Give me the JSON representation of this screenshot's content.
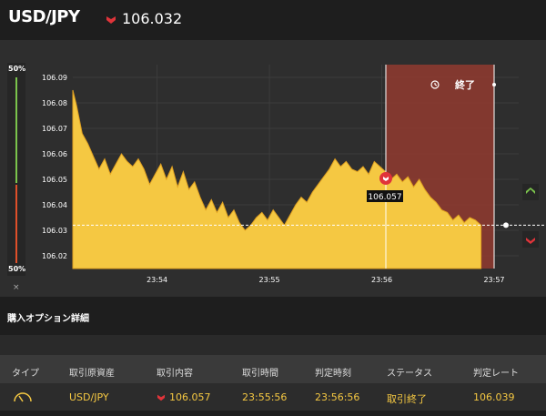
{
  "header": {
    "pair": "USD/JPY",
    "price": "106.032",
    "direction": "down"
  },
  "ratio": {
    "top_label": "50%",
    "bottom_label": "50%",
    "close_label": "×",
    "up_color": "#7bc44c",
    "down_color": "#e0502a"
  },
  "chart_data": {
    "type": "area",
    "y_ticks": [
      "106.09",
      "106.08",
      "106.07",
      "106.06",
      "106.05",
      "106.04",
      "106.03",
      "106.02"
    ],
    "x_ticks": [
      "23:54",
      "23:55",
      "23:56",
      "23:57"
    ],
    "ylim": [
      106.015,
      106.095
    ],
    "series": [
      {
        "color": "#f5c842",
        "points": [
          [
            "23:53:15",
            106.085
          ],
          [
            "23:53:17",
            106.079
          ],
          [
            "23:53:20",
            106.068
          ],
          [
            "23:53:23",
            106.064
          ],
          [
            "23:53:26",
            106.059
          ],
          [
            "23:53:29",
            106.054
          ],
          [
            "23:53:32",
            106.058
          ],
          [
            "23:53:35",
            106.052
          ],
          [
            "23:53:38",
            106.056
          ],
          [
            "23:53:41",
            106.06
          ],
          [
            "23:53:44",
            106.057
          ],
          [
            "23:53:47",
            106.055
          ],
          [
            "23:53:50",
            106.058
          ],
          [
            "23:53:53",
            106.054
          ],
          [
            "23:53:56",
            106.048
          ],
          [
            "23:53:59",
            106.052
          ],
          [
            "23:54:02",
            106.056
          ],
          [
            "23:54:05",
            106.05
          ],
          [
            "23:54:08",
            106.055
          ],
          [
            "23:54:11",
            106.047
          ],
          [
            "23:54:14",
            106.053
          ],
          [
            "23:54:17",
            106.046
          ],
          [
            "23:54:20",
            106.049
          ],
          [
            "23:54:23",
            106.043
          ],
          [
            "23:54:26",
            106.038
          ],
          [
            "23:54:29",
            106.042
          ],
          [
            "23:54:32",
            106.037
          ],
          [
            "23:54:35",
            106.041
          ],
          [
            "23:54:38",
            106.035
          ],
          [
            "23:54:41",
            106.038
          ],
          [
            "23:54:44",
            106.033
          ],
          [
            "23:54:47",
            106.03
          ],
          [
            "23:54:50",
            106.032
          ],
          [
            "23:54:53",
            106.035
          ],
          [
            "23:54:56",
            106.037
          ],
          [
            "23:54:59",
            106.034
          ],
          [
            "23:55:02",
            106.038
          ],
          [
            "23:55:05",
            106.035
          ],
          [
            "23:55:08",
            106.032
          ],
          [
            "23:55:11",
            106.036
          ],
          [
            "23:55:14",
            106.04
          ],
          [
            "23:55:17",
            106.043
          ],
          [
            "23:55:20",
            106.041
          ],
          [
            "23:55:23",
            106.045
          ],
          [
            "23:55:26",
            106.048
          ],
          [
            "23:55:29",
            106.051
          ],
          [
            "23:55:32",
            106.054
          ],
          [
            "23:55:35",
            106.058
          ],
          [
            "23:55:38",
            106.055
          ],
          [
            "23:55:41",
            106.057
          ],
          [
            "23:55:44",
            106.054
          ],
          [
            "23:55:47",
            106.053
          ],
          [
            "23:55:50",
            106.055
          ],
          [
            "23:55:53",
            106.052
          ],
          [
            "23:55:56",
            106.057
          ],
          [
            "23:55:59",
            106.055
          ],
          [
            "23:56:02",
            106.053
          ],
          [
            "23:56:05",
            106.05
          ],
          [
            "23:56:08",
            106.052
          ],
          [
            "23:56:11",
            106.049
          ],
          [
            "23:56:14",
            106.051
          ],
          [
            "23:56:17",
            106.047
          ],
          [
            "23:56:20",
            106.05
          ],
          [
            "23:56:23",
            106.046
          ],
          [
            "23:56:26",
            106.043
          ],
          [
            "23:56:29",
            106.041
          ],
          [
            "23:56:32",
            106.038
          ],
          [
            "23:56:35",
            106.037
          ],
          [
            "23:56:38",
            106.034
          ],
          [
            "23:56:41",
            106.036
          ],
          [
            "23:56:44",
            106.033
          ],
          [
            "23:56:47",
            106.035
          ],
          [
            "23:56:50",
            106.034
          ],
          [
            "23:56:53",
            106.032
          ]
        ]
      }
    ],
    "current_price_line": 106.032,
    "entry": {
      "time": "23:55:56",
      "price": "106.057",
      "direction": "down"
    },
    "expiry_time": "23:56:56",
    "expired_zone_label": "終了"
  },
  "options_section": {
    "title": "購入オプション詳細",
    "columns": [
      "タイプ",
      "取引原資産",
      "取引内容",
      "取引時間",
      "判定時刻",
      "ステータス",
      "判定レート"
    ],
    "rows": [
      {
        "asset": "USD/JPY",
        "trade": "106.057",
        "trade_direction": "down",
        "time": "23:55:56",
        "judge_time": "23:56:56",
        "status": "取引終了",
        "rate": "106.039"
      }
    ]
  }
}
